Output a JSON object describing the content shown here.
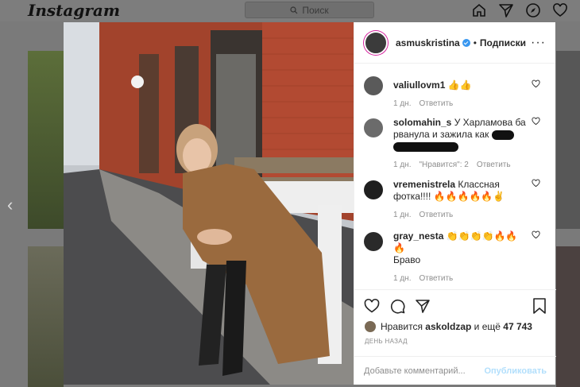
{
  "app": {
    "logo": "Instagram"
  },
  "search": {
    "placeholder": "Поиск"
  },
  "nav": {
    "icons": [
      "home-icon",
      "direct-icon",
      "explore-icon",
      "activity-icon"
    ]
  },
  "post": {
    "author": "asmuskristina",
    "separator": "•",
    "follow_status": "Подписки",
    "more": "···"
  },
  "comments": [
    {
      "user": "valiullovm1",
      "text": "👍👍",
      "time": "1 дн.",
      "likes": "",
      "reply": "Ответить"
    },
    {
      "user": "solomahin_s",
      "text_1": "У Харламова ба",
      "text_2": "рванула и зажила как",
      "time": "1 дн.",
      "likes": "\"Нравится\": 2",
      "reply": "Ответить"
    },
    {
      "user": "vremenistrela",
      "text": "Классная фотка!!!! 🔥🔥🔥🔥🔥✌",
      "time": "1 дн.",
      "likes": "",
      "reply": "Ответить"
    },
    {
      "user": "gray_nesta",
      "text": "👏👏👏👏🔥🔥🔥",
      "text_2": "Браво",
      "time": "1 дн.",
      "likes": "",
      "reply": "Ответить"
    }
  ],
  "likes": {
    "prefix": "Нравится",
    "user": "askoldzap",
    "suffix": "и ещё",
    "count": "47 743"
  },
  "date": "ДЕНЬ НАЗАД",
  "add_comment": {
    "placeholder": "Добавьте комментарий...",
    "publish": "Опубликовать"
  },
  "colors": {
    "accent": "#3897f0",
    "publish_disabled": "#b2dffc"
  }
}
